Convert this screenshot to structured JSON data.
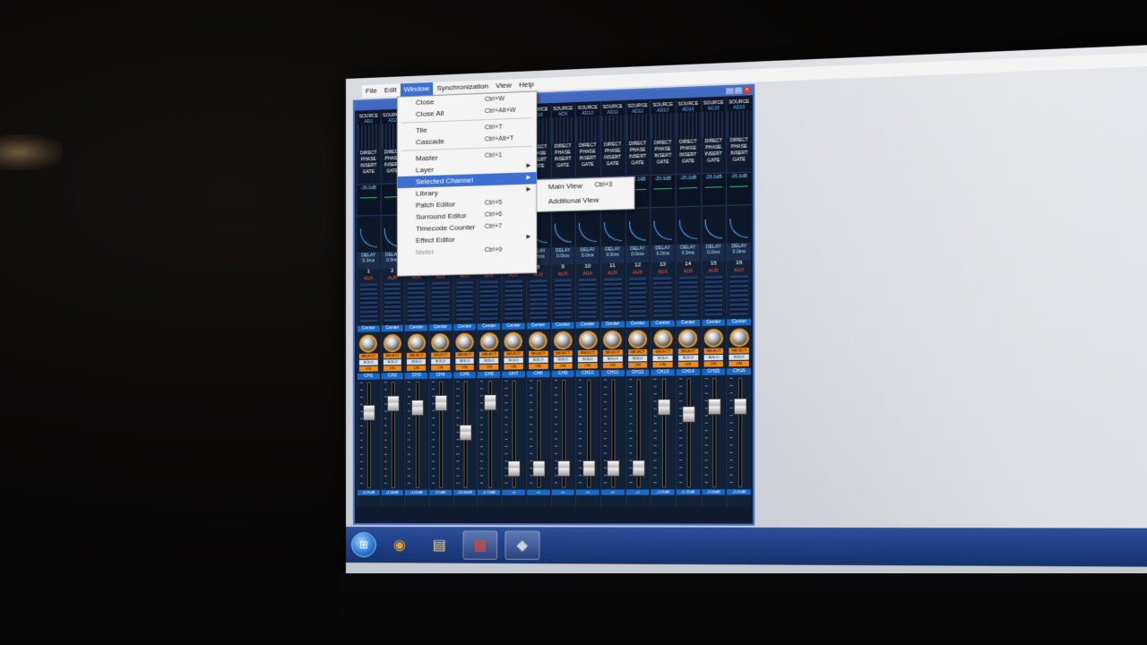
{
  "menubar": {
    "items": [
      "File",
      "Edit",
      "Window",
      "Synchronization",
      "View",
      "Help"
    ]
  },
  "window_menu": {
    "items": [
      {
        "label": "Close",
        "shortcut": "Ctrl+W",
        "state": "normal"
      },
      {
        "label": "Close All",
        "shortcut": "Ctrl+Alt+W",
        "state": "normal"
      },
      {
        "label": "Tile",
        "shortcut": "Ctrl+T",
        "state": "normal"
      },
      {
        "label": "Cascade",
        "shortcut": "Ctrl+Alt+T",
        "state": "normal"
      },
      {
        "label": "Master",
        "shortcut": "Ctrl+1",
        "state": "normal"
      },
      {
        "label": "Layer",
        "shortcut": "",
        "state": "submenu"
      },
      {
        "label": "Selected Channel",
        "shortcut": "",
        "state": "selected"
      },
      {
        "label": "Library",
        "shortcut": "",
        "state": "submenu"
      },
      {
        "label": "Patch Editor",
        "shortcut": "Ctrl+5",
        "state": "normal"
      },
      {
        "label": "Surround Editor",
        "shortcut": "Ctrl+6",
        "state": "normal"
      },
      {
        "label": "Timecode Counter",
        "shortcut": "Ctrl+7",
        "state": "normal"
      },
      {
        "label": "Effect Editor",
        "shortcut": "",
        "state": "submenu"
      },
      {
        "label": "Meter",
        "shortcut": "Ctrl+9",
        "state": "disabled"
      }
    ]
  },
  "selected_channel_submenu": {
    "items": [
      {
        "label": "Main View",
        "shortcut": "Ctrl+3"
      },
      {
        "label": "Additional View",
        "shortcut": ""
      }
    ]
  },
  "mixer": {
    "source_label": "SOURCE",
    "direct_label": "DIRECT",
    "phase_label": "PHASE",
    "insert_label": "INSERT",
    "gate_label": "GATE",
    "delay_label": "DELAY",
    "delay_value": "0.0ms",
    "aux_label": "AUX",
    "pan_label": "Center",
    "select_label": "SELECT",
    "solo_label": "SOLO",
    "on_label": "ON",
    "channels": [
      {
        "num": "1",
        "name": "CH1",
        "source": "AD1",
        "eq_db": "-26.0dB",
        "level": "-6.25dB",
        "fader_pos": 0.25
      },
      {
        "num": "2",
        "name": "CH2",
        "source": "AD2",
        "eq_db": "",
        "level": "-2.00dB",
        "fader_pos": 0.15
      },
      {
        "num": "3",
        "name": "CH3",
        "source": "AD3",
        "eq_db": "",
        "level": "-1.05dB",
        "fader_pos": 0.2
      },
      {
        "num": "4",
        "name": "CH4",
        "source": "AD4",
        "eq_db": "",
        "level": "0.5dB",
        "fader_pos": 0.15
      },
      {
        "num": "5",
        "name": "CH5",
        "source": "AD5",
        "eq_db": "",
        "level": "-15.60dB",
        "fader_pos": 0.48
      },
      {
        "num": "6",
        "name": "CH6",
        "source": "AD6",
        "eq_db": "",
        "level": "-5.15dB",
        "fader_pos": 0.15
      },
      {
        "num": "7",
        "name": "CH7",
        "source": "AD7",
        "eq_db": "",
        "level": "-∞",
        "fader_pos": 0.88
      },
      {
        "num": "8",
        "name": "CH8",
        "source": "AD8",
        "eq_db": "",
        "level": "-∞",
        "fader_pos": 0.88
      },
      {
        "num": "9",
        "name": "CH9",
        "source": "AD9",
        "eq_db": "",
        "level": "-∞",
        "fader_pos": 0.88
      },
      {
        "num": "10",
        "name": "CH10",
        "source": "AD10",
        "eq_db": "",
        "level": "-∞",
        "fader_pos": 0.88
      },
      {
        "num": "11",
        "name": "CH11",
        "source": "AD11",
        "eq_db": "",
        "level": "-∞",
        "fader_pos": 0.88
      },
      {
        "num": "12",
        "name": "CH12",
        "source": "AD12",
        "eq_db": "-26.0dB",
        "level": "-∞",
        "fader_pos": 0.88
      },
      {
        "num": "13",
        "name": "CH13",
        "source": "AD13",
        "eq_db": "-26.0dB",
        "level": "-1.25dB",
        "fader_pos": 0.22
      },
      {
        "num": "14",
        "name": "CH14",
        "source": "AD14",
        "eq_db": "-26.0dB",
        "level": "-5.15dB",
        "fader_pos": 0.3
      },
      {
        "num": "15",
        "name": "CH15",
        "source": "AD15",
        "eq_db": "-26.0dB",
        "level": "-2.00dB",
        "fader_pos": 0.22
      },
      {
        "num": "16",
        "name": "CH16",
        "source": "AD16",
        "eq_db": "-26.0dB",
        "level": "-2.00dB",
        "fader_pos": 0.22
      }
    ]
  },
  "taskbar": {
    "apps": [
      {
        "icon": "chrome-icon",
        "glyph": "◉",
        "color": "#e5a12b"
      },
      {
        "icon": "folder-icon",
        "glyph": "▤",
        "color": "#f2d27a"
      },
      {
        "icon": "mixer-app-icon",
        "glyph": "▦",
        "color": "#d9483b"
      },
      {
        "icon": "tool-app-icon",
        "glyph": "◆",
        "color": "#c9d3de"
      }
    ]
  }
}
